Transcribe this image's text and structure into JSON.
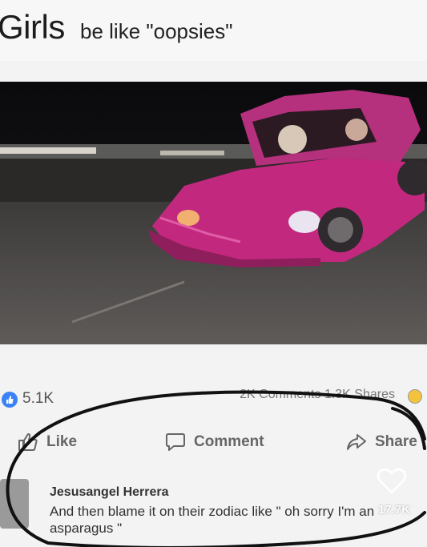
{
  "caption": {
    "big": "Girls",
    "rest": "be like \"oopsies\""
  },
  "post": {
    "reactions_count": "5.1K",
    "comments_shares": "2K Comments   1.3K Shares"
  },
  "actions": {
    "like": "Like",
    "comment": "Comment",
    "share": "Share"
  },
  "comment": {
    "author": "Jesusangel Herrera",
    "text": "And then blame it on their zodiac like \" oh sorry I'm an asparagus \""
  },
  "overlay": {
    "like_count": "17.7K"
  },
  "icons": {
    "like": "thumbs-up-icon",
    "comment": "speech-bubble-icon",
    "share": "share-arrow-icon",
    "heart": "heart-icon"
  },
  "colors": {
    "car": "#c2297e",
    "like_badge": "#3b82f6",
    "ink": "#111111"
  }
}
